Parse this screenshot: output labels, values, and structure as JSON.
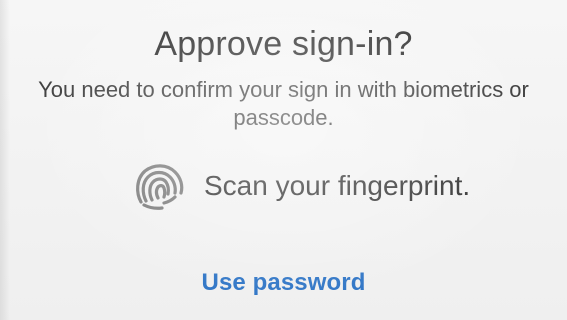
{
  "dialog": {
    "title": "Approve sign-in?",
    "subtitle": "You need to confirm your sign in with biometrics or passcode.",
    "fingerprint": {
      "icon": "fingerprint-icon",
      "text": "Scan your fingerprint."
    },
    "use_password_label": "Use password"
  },
  "colors": {
    "text_primary": "#2f2f2f",
    "text_secondary": "#3d3d3d",
    "link": "#2f75c6",
    "background": "#f3f3f3"
  }
}
